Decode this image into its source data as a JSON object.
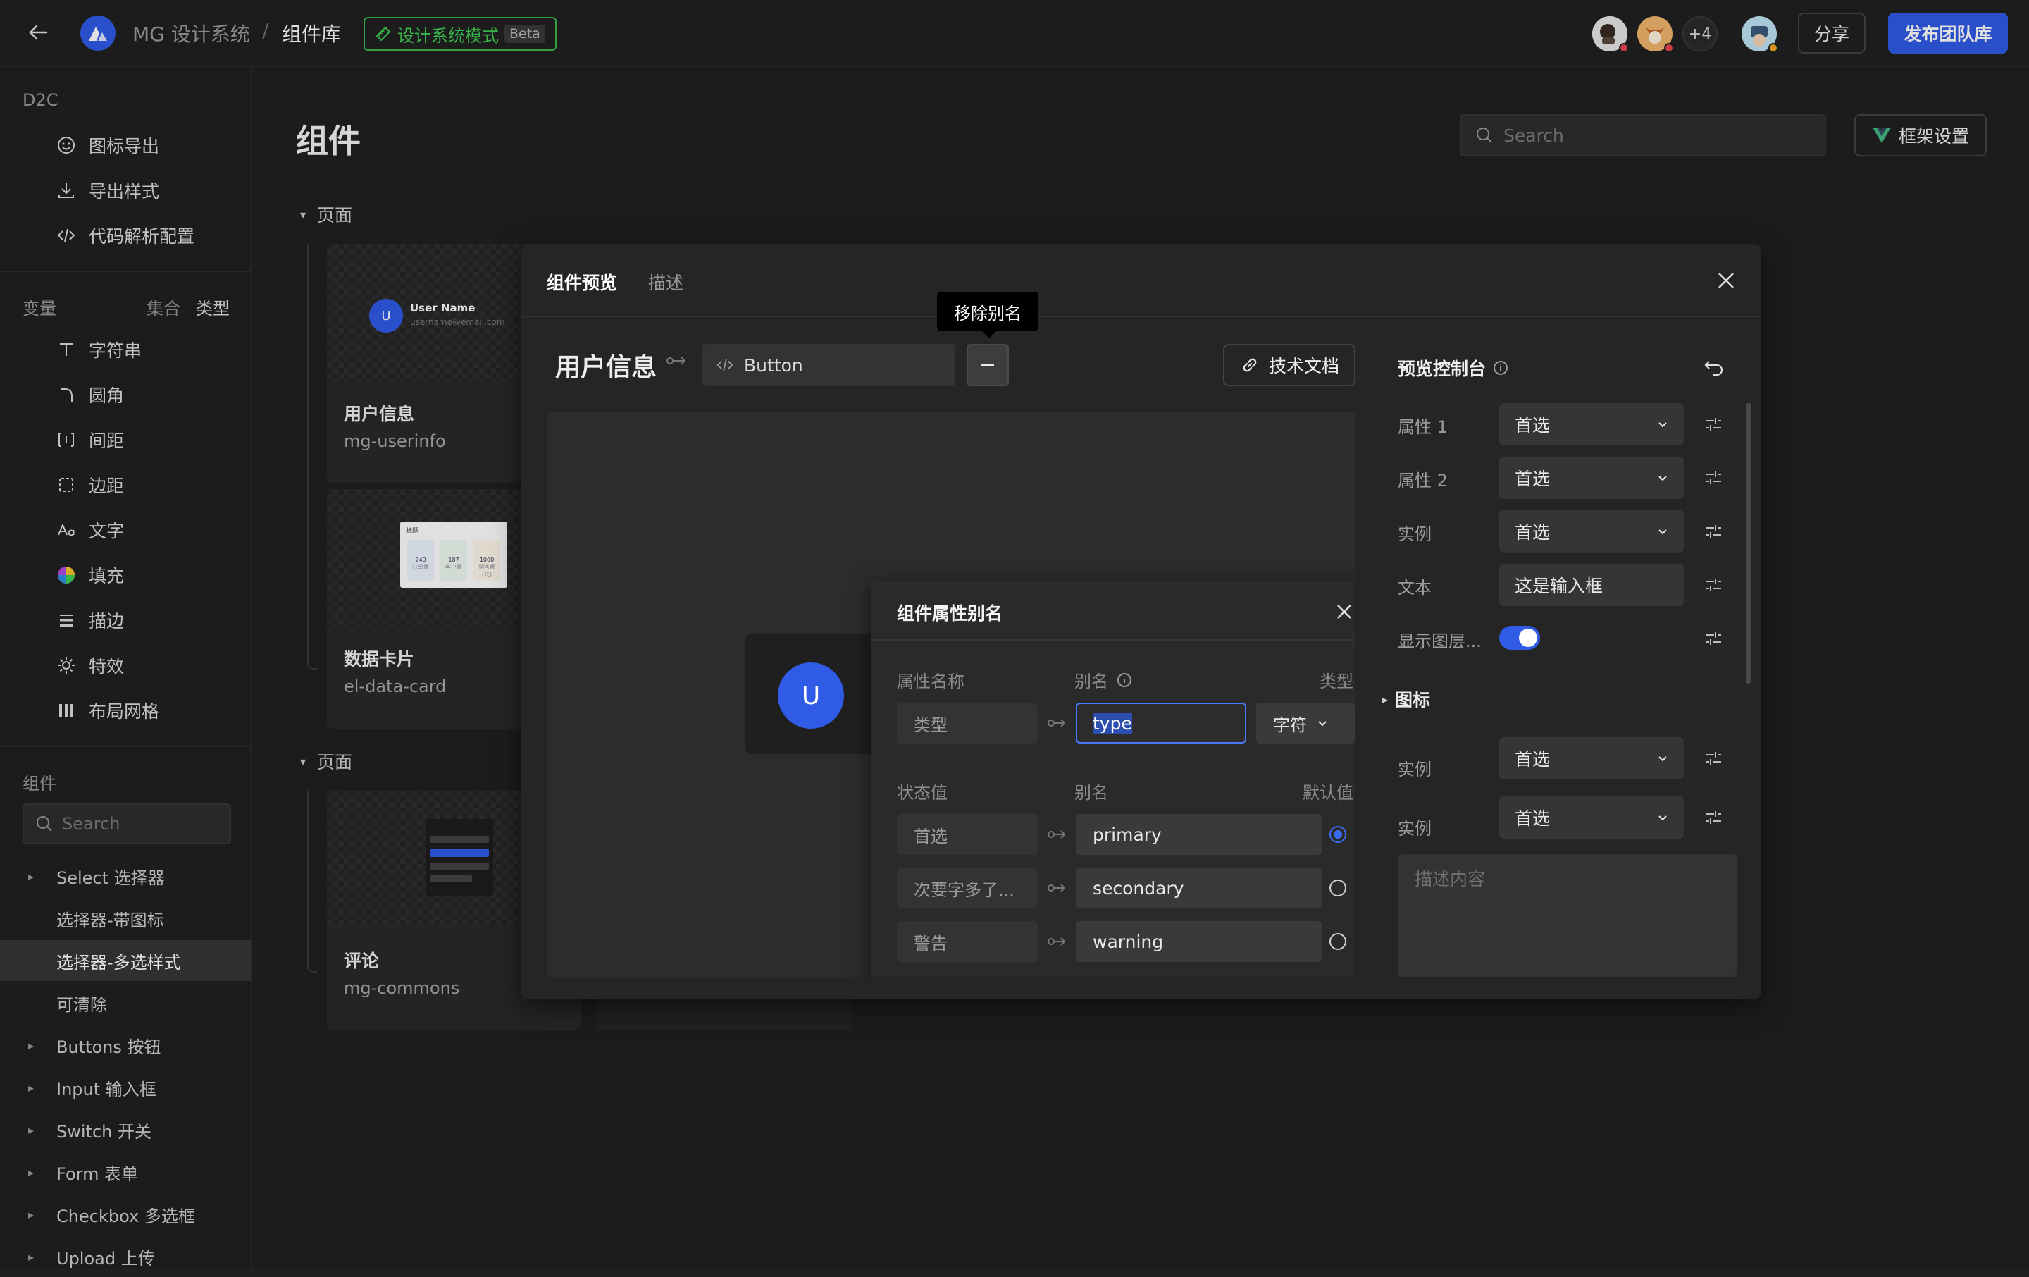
{
  "header": {
    "project_name": "MG 设计系统",
    "separator": "/",
    "page_name": "组件库",
    "mode_label": "设计系统模式",
    "beta_label": "Beta",
    "more_avatars": "+4",
    "share_label": "分享",
    "publish_label": "发布团队库"
  },
  "sidebar": {
    "d2c_heading": "D2C",
    "d2c_items": [
      "图标导出",
      "导出样式",
      "代码解析配置"
    ],
    "variables_heading": "变量",
    "variables_tab_collection": "集合",
    "variables_tab_type": "类型",
    "variable_items": [
      "字符串",
      "圆角",
      "间距",
      "边距",
      "文字",
      "填充",
      "描边",
      "特效",
      "布局网格"
    ],
    "components_heading": "组件",
    "search_placeholder": "Search",
    "tree": [
      {
        "label": "Select 选择器",
        "level": 0
      },
      {
        "label": "选择器-带图标",
        "level": 1
      },
      {
        "label": "选择器-多选样式",
        "level": 1,
        "selected": true
      },
      {
        "label": "可清除",
        "level": 1
      },
      {
        "label": "Buttons 按钮",
        "level": 0
      },
      {
        "label": "Input 输入框",
        "level": 0
      },
      {
        "label": "Switch 开关",
        "level": 0
      },
      {
        "label": "Form 表单",
        "level": 0
      },
      {
        "label": "Checkbox 多选框",
        "level": 0
      },
      {
        "label": "Upload 上传",
        "level": 0
      }
    ]
  },
  "main": {
    "title": "组件",
    "search_placeholder": "Search",
    "framework_button": "框架设置",
    "sections": [
      {
        "label": "页面"
      },
      {
        "label": "页面"
      }
    ],
    "cards": [
      {
        "name": "用户信息",
        "code": "mg-userinfo",
        "thumb_user_name": "User Name",
        "thumb_user_email": "username@email.com",
        "thumb_avatar": "U"
      },
      {
        "name": "数据卡片",
        "code": "el-data-card",
        "thumb_header": "标题",
        "thumb_values": [
          "240",
          "187",
          "1000"
        ],
        "thumb_captions": [
          "订单量",
          "客户量",
          "销售额(元)"
        ]
      },
      {
        "name": "评论",
        "code": "mg-commons"
      }
    ]
  },
  "modal": {
    "tabs": [
      "组件预览",
      "描述"
    ],
    "component_title": "用户信息",
    "component_code": "Button",
    "tooltip": "移除别名",
    "tech_doc_button": "技术文档",
    "preview_avatar": "U",
    "alias_popup": {
      "title": "组件属性别名",
      "col_prop_name": "属性名称",
      "col_alias": "别名",
      "col_type": "类型",
      "prop_key": "类型",
      "prop_alias": "type",
      "prop_type": "字符",
      "col_state": "状态值",
      "col_alias2": "别名",
      "col_default": "默认值",
      "states": [
        {
          "key": "首选",
          "alias": "primary",
          "default": true
        },
        {
          "key": "次要字多了...",
          "alias": "secondary",
          "default": false
        },
        {
          "key": "警告",
          "alias": "warning",
          "default": false
        }
      ]
    },
    "control_panel": {
      "title": "预览控制台",
      "rows": [
        {
          "label": "属性 1",
          "kind": "select",
          "value": "首选"
        },
        {
          "label": "属性 2",
          "kind": "select",
          "value": "首选"
        },
        {
          "label": "实例",
          "kind": "select",
          "value": "首选"
        },
        {
          "label": "文本",
          "kind": "text",
          "value": "这是输入框"
        },
        {
          "label": "显示图层...",
          "kind": "toggle",
          "value": true
        }
      ],
      "icon_section_label": "图标",
      "icon_rows": [
        {
          "label": "实例",
          "value": "首选"
        },
        {
          "label": "实例",
          "value": "首选"
        }
      ],
      "description_placeholder": "描述内容"
    }
  },
  "colors": {
    "accent": "#2f5be7",
    "mode_green": "#3fcf55",
    "background": "#202020"
  }
}
